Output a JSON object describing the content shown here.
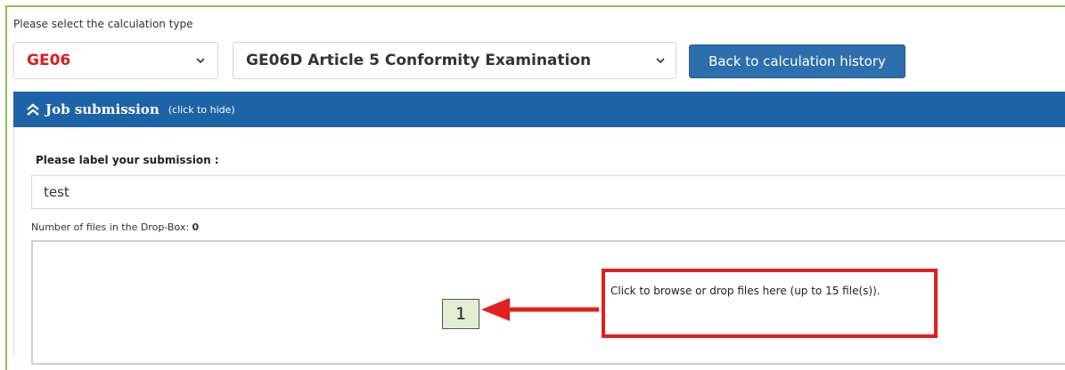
{
  "calc_selector": {
    "prompt": "Please select the calculation type",
    "type_value": "GE06",
    "calculation_value": "GE06D Article 5 Conformity Examination",
    "back_button_label": "Back to calculation history"
  },
  "job_submission": {
    "title": "Job submission",
    "hint": "(click to hide)",
    "label_prompt": "Please label your submission :",
    "label_value": "test",
    "files_count_label": "Number of files in the Drop-Box:",
    "files_count_value": "0",
    "dropbox_text": "Click to browse or drop files here (up to 15 file(s))."
  },
  "annotation": {
    "step_number": "1"
  },
  "colors": {
    "accent_blue": "#1d63a7",
    "button_blue": "#2d6ead",
    "highlight_red": "#e02020",
    "type_red": "#e01b1b",
    "frame_green": "#8fbf57",
    "badge_bg": "#e3edd2"
  },
  "icons": {
    "dropdown": "chevron-down-icon",
    "collapse": "double-chevron-up-icon",
    "pointer": "arrow-left-icon"
  }
}
